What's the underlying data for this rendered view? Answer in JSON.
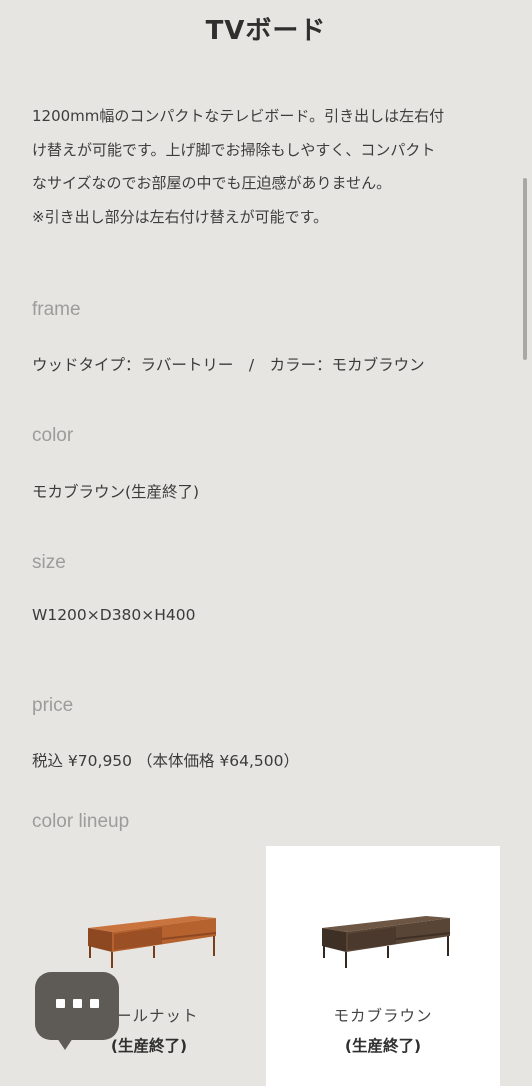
{
  "header": {
    "title": "TVボード"
  },
  "description": {
    "lines": [
      "1200mm幅のコンパクトなテレビボード。引き出しは左右付",
      "け替えが可能です。上げ脚でお掃除もしやすく、コンパクト",
      "なサイズなのでお部屋の中でも圧迫感がありません。",
      "※引き出し部分は左右付け替えが可能です。"
    ]
  },
  "specs": {
    "frame": {
      "label": "frame",
      "value": "ウッドタイプ：ラバートリー　/　カラー：モカブラウン"
    },
    "color": {
      "label": "color",
      "value": "モカブラウン(生産終了)"
    },
    "size": {
      "label": "size",
      "value": "W1200×D380×H400"
    },
    "price": {
      "label": "price",
      "value": "税込 ¥70,950 （本体価格 ¥64,500）"
    }
  },
  "lineup": {
    "label": "color lineup",
    "items": [
      {
        "name": "ウォールナット",
        "visible_name": "ォールナット",
        "status": "(生産終了)",
        "color": "#a0562b",
        "selected": false
      },
      {
        "name": "モカブラウン",
        "visible_name": "モカブラウン",
        "status": "(生産終了)",
        "color": "#5a4534",
        "selected": true
      }
    ]
  },
  "chat": {
    "icon": "chat-bubble-icon"
  },
  "colors": {
    "background": "#e6e5e1",
    "text": "#3a3a3a",
    "muted_label": "#9c9c9a",
    "chat_bg": "#5e5b56"
  }
}
